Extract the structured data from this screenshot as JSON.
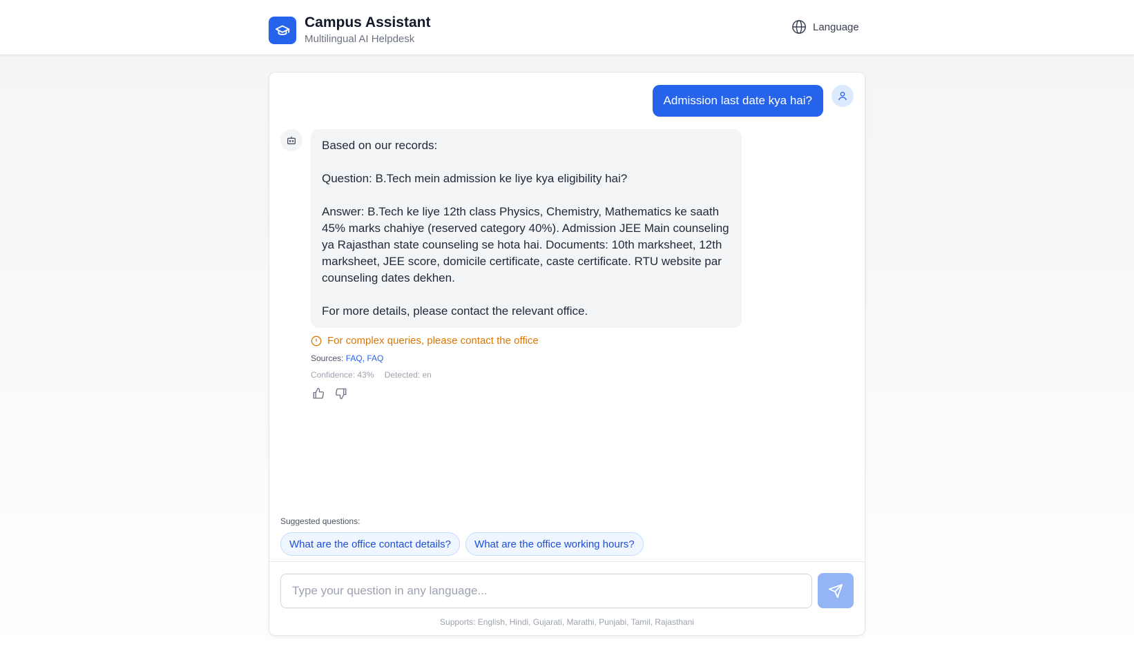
{
  "header": {
    "title": "Campus Assistant",
    "subtitle": "Multilingual AI Helpdesk",
    "language_label": "Language",
    "logo_icon": "graduation-cap-icon",
    "language_icon": "globe-icon"
  },
  "chat": {
    "user_message": "Admission last date kya hai?",
    "bot_message": "Based on our records:\n\nQuestion: B.Tech mein admission ke liye kya eligibility hai?\n\nAnswer: B.Tech ke liye 12th class Physics, Chemistry, Mathematics ke saath 45% marks chahiye (reserved category 40%). Admission JEE Main counseling ya Rajasthan state counseling se hota hai. Documents: 10th marksheet, 12th marksheet, JEE score, domicile certificate, caste certificate. RTU website par counseling dates dekhen.\n\nFor more details, please contact the relevant office.",
    "warning": "For complex queries, please contact the office",
    "sources_label": "Sources:",
    "sources": "FAQ, FAQ",
    "confidence": "Confidence: 43%",
    "detected": "Detected: en"
  },
  "suggestions": {
    "label": "Suggested questions:",
    "items": [
      "What are the office contact details?",
      "What are the office working hours?"
    ]
  },
  "composer": {
    "placeholder": "Type your question in any language...",
    "value": "",
    "supports": "Supports: English, Hindi, Gujarati, Marathi, Punjabi, Tamil, Rajasthani"
  },
  "colors": {
    "primary": "#2563eb",
    "warning": "#d97706",
    "send_disabled": "#93b4f5"
  }
}
